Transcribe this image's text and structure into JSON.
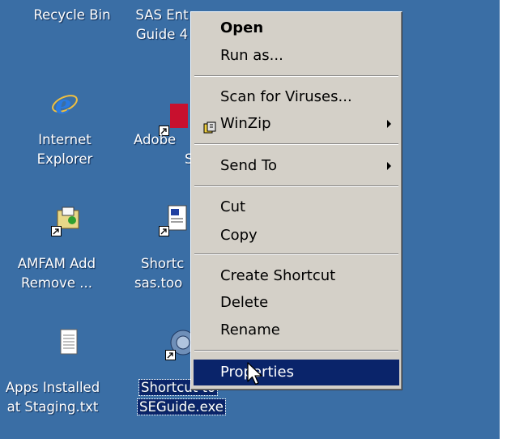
{
  "desktop": {
    "icons": [
      {
        "label_lines": [
          "Recycle Bin"
        ]
      },
      {
        "label_lines": [
          "SAS Ent",
          "Guide 4"
        ]
      },
      {
        "label_lines": [
          "Internet",
          "Explorer"
        ]
      },
      {
        "label_lines": [
          "Adobe",
          "S"
        ]
      },
      {
        "label_lines": [
          "AMFAM Add",
          "Remove ..."
        ]
      },
      {
        "label_lines": [
          "Shortc",
          "sas.too"
        ]
      },
      {
        "label_lines": [
          "Apps Installed",
          "at Staging.txt"
        ]
      },
      {
        "label_lines": [
          "Shortcut to",
          "SEGuide.exe"
        ]
      }
    ]
  },
  "context_menu": {
    "open": "Open",
    "run_as": "Run as...",
    "scan": "Scan for Viruses...",
    "winzip": "WinZip",
    "send_to": "Send To",
    "cut": "Cut",
    "copy": "Copy",
    "create_shortcut": "Create Shortcut",
    "delete": "Delete",
    "rename": "Rename",
    "properties": "Properties"
  },
  "colors": {
    "desktop_bg": "#3a6ea5",
    "menu_bg": "#d4d0c8",
    "highlight": "#0a246a"
  }
}
